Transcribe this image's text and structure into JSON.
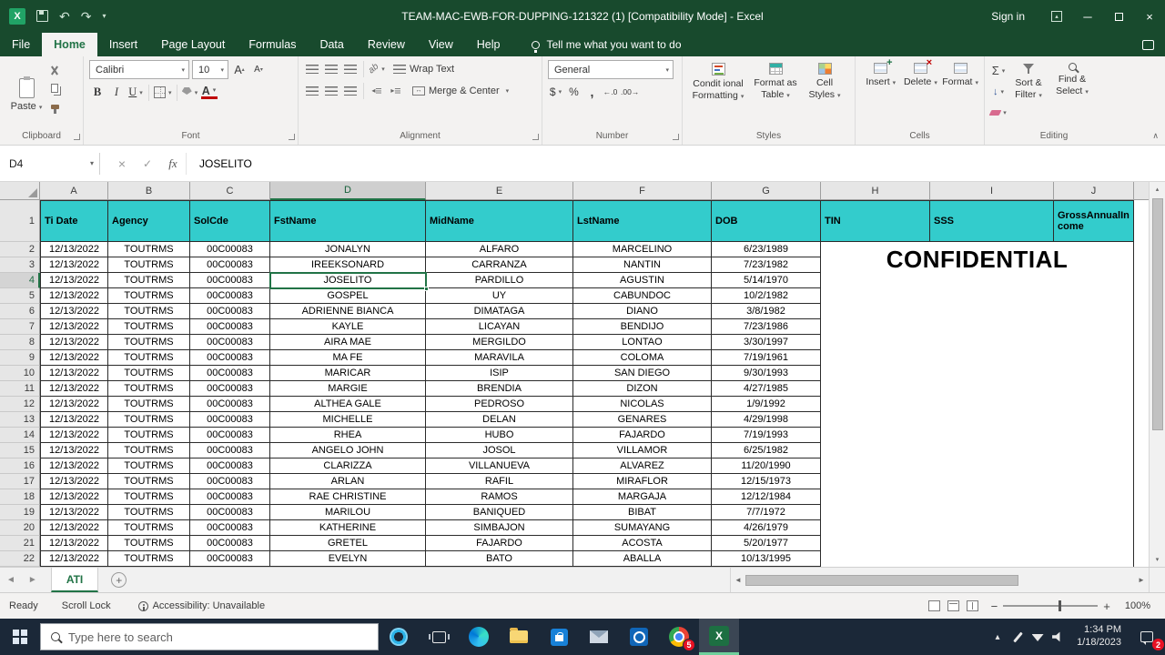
{
  "colors": {
    "accent_green": "#217346",
    "titlebar_green": "#184a2d",
    "header_teal": "#33cccc",
    "taskbar_navy": "#1b2838"
  },
  "title_bar": {
    "title": "TEAM-MAC-EWB-FOR-DUPPING-121322 (1)  [Compatibility Mode] -  Excel",
    "sign_in": "Sign in"
  },
  "tabs": {
    "items": [
      "File",
      "Home",
      "Insert",
      "Page Layout",
      "Formulas",
      "Data",
      "Review",
      "View",
      "Help"
    ],
    "active": "Home",
    "tell_me": "Tell me what you want to do"
  },
  "ribbon": {
    "clipboard": {
      "paste": "Paste",
      "label": "Clipboard"
    },
    "font": {
      "family": "Calibri",
      "size": "10",
      "label": "Font"
    },
    "alignment": {
      "wrap_text": "Wrap Text",
      "merge_center": "Merge & Center",
      "label": "Alignment"
    },
    "number": {
      "format": "General",
      "label": "Number"
    },
    "styles": {
      "conditional": "Condit ional Formatting",
      "format_table": "Format as Table",
      "cell_styles": "Cell Styles",
      "label": "Styles"
    },
    "cells": {
      "insert": "Insert",
      "delete": "Delete",
      "format": "Format",
      "label": "Cells"
    },
    "editing": {
      "sort_filter": "Sort & Filter",
      "find_select": "Find & Select",
      "label": "Editing"
    }
  },
  "formula_bar": {
    "name_box": "D4",
    "fx": "fx",
    "value": "JOSELITO"
  },
  "grid": {
    "columns": [
      "A",
      "B",
      "C",
      "D",
      "E",
      "F",
      "G",
      "H",
      "I",
      "J"
    ],
    "selected_column": "D",
    "selected_row": 4,
    "selected_cell": "D4",
    "header_row": [
      "Ti Date",
      "Agency",
      "SolCde",
      "FstName",
      "MidName",
      "LstName",
      "DOB",
      "TIN",
      "SSS",
      "GrossAnnualIncome"
    ],
    "rows": [
      [
        "12/13/2022",
        "TOUTRMS",
        "00C00083",
        "JONALYN",
        "ALFARO",
        "MARCELINO",
        "6/23/1989"
      ],
      [
        "12/13/2022",
        "TOUTRMS",
        "00C00083",
        "IREEKSONARD",
        "CARRANZA",
        "NANTIN",
        "7/23/1982"
      ],
      [
        "12/13/2022",
        "TOUTRMS",
        "00C00083",
        "JOSELITO",
        "PARDILLO",
        "AGUSTIN",
        "5/14/1970"
      ],
      [
        "12/13/2022",
        "TOUTRMS",
        "00C00083",
        "GOSPEL",
        "UY",
        "CABUNDOC",
        "10/2/1982"
      ],
      [
        "12/13/2022",
        "TOUTRMS",
        "00C00083",
        "ADRIENNE BIANCA",
        "DIMATAGA",
        "DIANO",
        "3/8/1982"
      ],
      [
        "12/13/2022",
        "TOUTRMS",
        "00C00083",
        "KAYLE",
        "LICAYAN",
        "BENDIJO",
        "7/23/1986"
      ],
      [
        "12/13/2022",
        "TOUTRMS",
        "00C00083",
        "AIRA MAE",
        "MERGILDO",
        "LONTAO",
        "3/30/1997"
      ],
      [
        "12/13/2022",
        "TOUTRMS",
        "00C00083",
        "MA FE",
        "MARAVILA",
        "COLOMA",
        "7/19/1961"
      ],
      [
        "12/13/2022",
        "TOUTRMS",
        "00C00083",
        "MARICAR",
        "ISIP",
        "SAN DIEGO",
        "9/30/1993"
      ],
      [
        "12/13/2022",
        "TOUTRMS",
        "00C00083",
        "MARGIE",
        "BRENDIA",
        "DIZON",
        "4/27/1985"
      ],
      [
        "12/13/2022",
        "TOUTRMS",
        "00C00083",
        "ALTHEA GALE",
        "PEDROSO",
        "NICOLAS",
        "1/9/1992"
      ],
      [
        "12/13/2022",
        "TOUTRMS",
        "00C00083",
        "MICHELLE",
        "DELAN",
        "GENARES",
        "4/29/1998"
      ],
      [
        "12/13/2022",
        "TOUTRMS",
        "00C00083",
        "RHEA",
        "HUBO",
        "FAJARDO",
        "7/19/1993"
      ],
      [
        "12/13/2022",
        "TOUTRMS",
        "00C00083",
        "ANGELO JOHN",
        "JOSOL",
        "VILLAMOR",
        "6/25/1982"
      ],
      [
        "12/13/2022",
        "TOUTRMS",
        "00C00083",
        "CLARIZZA",
        "VILLANUEVA",
        "ALVAREZ",
        "11/20/1990"
      ],
      [
        "12/13/2022",
        "TOUTRMS",
        "00C00083",
        "ARLAN",
        "RAFIL",
        "MIRAFLOR",
        "12/15/1973"
      ],
      [
        "12/13/2022",
        "TOUTRMS",
        "00C00083",
        "RAE CHRISTINE",
        "RAMOS",
        "MARGAJA",
        "12/12/1984"
      ],
      [
        "12/13/2022",
        "TOUTRMS",
        "00C00083",
        "MARILOU",
        "BANIQUED",
        "BIBAT",
        "7/7/1972"
      ],
      [
        "12/13/2022",
        "TOUTRMS",
        "00C00083",
        "KATHERINE",
        "SIMBAJON",
        "SUMAYANG",
        "4/26/1979"
      ],
      [
        "12/13/2022",
        "TOUTRMS",
        "00C00083",
        "GRETEL",
        "FAJARDO",
        "ACOSTA",
        "5/20/1977"
      ],
      [
        "12/13/2022",
        "TOUTRMS",
        "00C00083",
        "EVELYN",
        "BATO",
        "ABALLA",
        "10/13/1995"
      ]
    ],
    "confidential": "CONFIDENTIAL"
  },
  "sheet_bar": {
    "tab": "ATI"
  },
  "status_bar": {
    "mode": "Ready",
    "scroll_lock": "Scroll Lock",
    "accessibility": "Accessibility: Unavailable",
    "zoom": "100%"
  },
  "taskbar": {
    "search_placeholder": "Type here to search",
    "chrome_badge": "5",
    "time": "1:34 PM",
    "date": "1/18/2023",
    "notification_badge": "2"
  }
}
